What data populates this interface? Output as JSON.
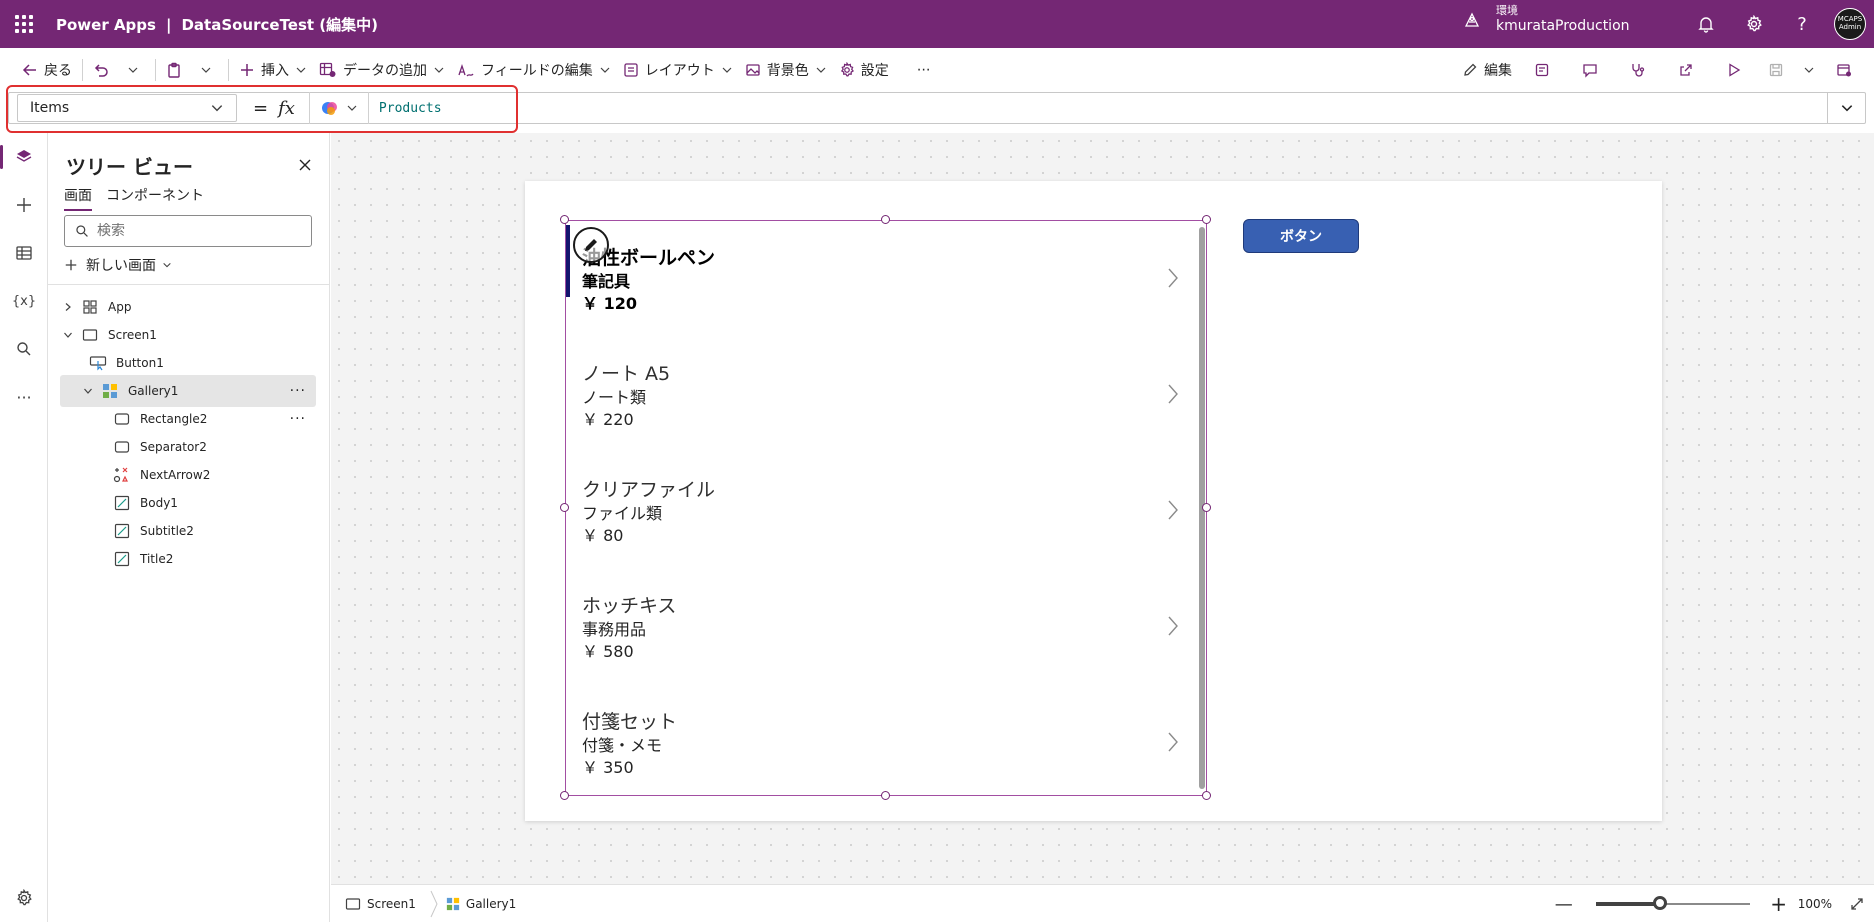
{
  "header": {
    "app_name": "Power Apps",
    "separator": "|",
    "doc_title": "DataSourceTest (編集中)",
    "env_label": "環境",
    "env_name": "kmurataProduction",
    "avatar_line1": "MCAPS",
    "avatar_line2": "Admin",
    "bg_color": "#742774"
  },
  "commandbar": {
    "back": "戻る",
    "insert": "挿入",
    "add_data": "データの追加",
    "edit_fields": "フィールドの編集",
    "layout": "レイアウト",
    "background": "背景色",
    "settings": "設定",
    "more": "⋯",
    "edit": "編集"
  },
  "formula": {
    "property": "Items",
    "equals": "=",
    "fx": "fx",
    "value": "Products"
  },
  "tree": {
    "title": "ツリー ビュー",
    "tabs": [
      "画面",
      "コンポーネント"
    ],
    "search_placeholder": "検索",
    "new_screen": "新しい画面",
    "nodes": [
      {
        "label": "App",
        "icon": "app-icon"
      },
      {
        "label": "Screen1",
        "icon": "screen-icon"
      },
      {
        "label": "Button1",
        "icon": "button-icon"
      },
      {
        "label": "Gallery1",
        "icon": "gallery-icon"
      },
      {
        "label": "Rectangle2",
        "icon": "rectangle-icon"
      },
      {
        "label": "Separator2",
        "icon": "separator-icon"
      },
      {
        "label": "NextArrow2",
        "icon": "icon-control-icon"
      },
      {
        "label": "Body1",
        "icon": "label-icon"
      },
      {
        "label": "Subtitle2",
        "icon": "label-icon"
      },
      {
        "label": "Title2",
        "icon": "label-icon"
      }
    ]
  },
  "gallery": {
    "items": [
      {
        "title": "油性ボールペン",
        "subtitle": "筆記具",
        "body": "￥ 120"
      },
      {
        "title": "ノート A5",
        "subtitle": "ノート類",
        "body": "￥ 220"
      },
      {
        "title": "クリアファイル",
        "subtitle": "ファイル類",
        "body": "￥ 80"
      },
      {
        "title": "ホッチキス",
        "subtitle": "事務用品",
        "body": "￥ 580"
      },
      {
        "title": "付箋セット",
        "subtitle": "付箋・メモ",
        "body": "￥ 350"
      }
    ],
    "selected_bar_color": "#14146e"
  },
  "button": {
    "label": "ボタン",
    "color": "#3860b2"
  },
  "statusbar": {
    "crumb1": "Screen1",
    "crumb2": "Gallery1",
    "zoom_minus": "—",
    "zoom_plus": "+",
    "zoom": "100%",
    "zoom_level": 0.42
  }
}
